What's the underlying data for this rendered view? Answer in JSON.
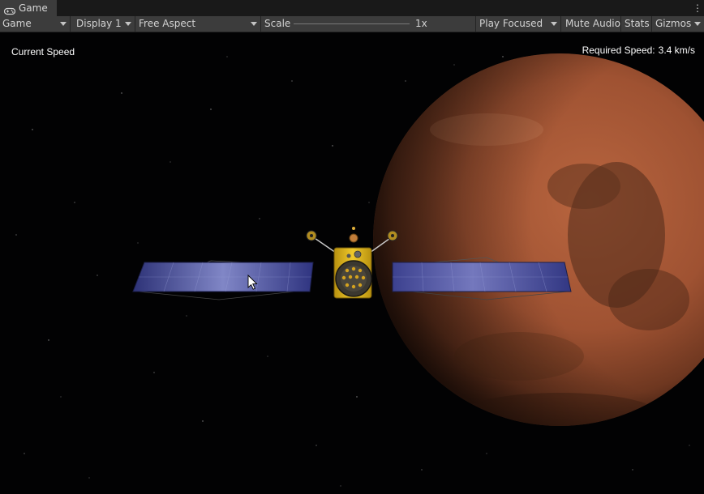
{
  "window": {
    "tab_label": "Game",
    "tab_icon": "gamepad-icon",
    "menu_icon": "kebab-menu-icon"
  },
  "toolbar": {
    "view_dropdown": "Game",
    "display_dropdown": "Display 1",
    "aspect_dropdown": "Free Aspect",
    "scale_label": "Scale",
    "scale_value": "1x",
    "play_mode_dropdown": "Play Focused",
    "mute_audio": "Mute Audio",
    "stats": "Stats",
    "gizmos": "Gizmos"
  },
  "hud": {
    "current_speed_label": "Current Speed",
    "required_speed_label": "Required Speed:",
    "required_speed_value": "3.4 km/s"
  },
  "colors": {
    "editor_dark": "#3c3c3c",
    "tab_strip": "#191919",
    "space": "#020203",
    "mars": "#a8593a",
    "solar_panel": "#3a3f8e",
    "probe_body": "#d8b21f"
  }
}
